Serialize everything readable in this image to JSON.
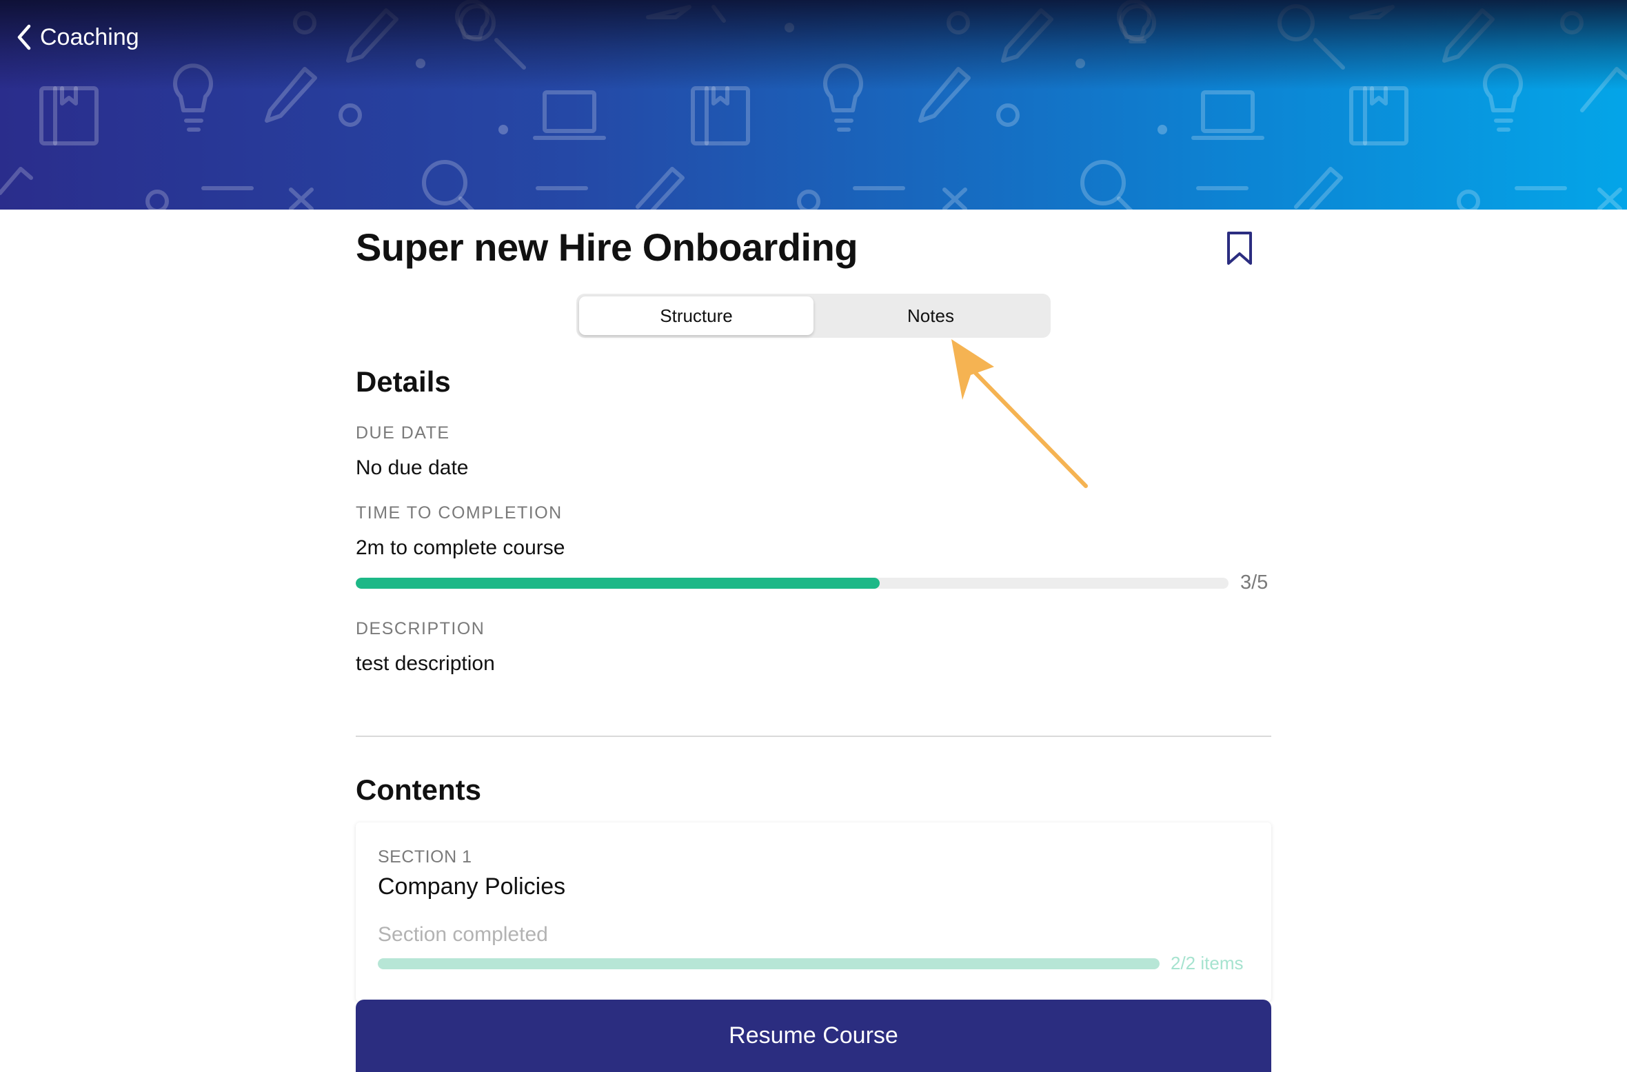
{
  "header": {
    "back_label": "Coaching"
  },
  "course": {
    "title": "Super new Hire Onboarding"
  },
  "tabs": [
    {
      "label": "Structure",
      "active": true
    },
    {
      "label": "Notes",
      "active": false
    }
  ],
  "details": {
    "heading": "Details",
    "due_date_label": "DUE DATE",
    "due_date_value": "No due date",
    "time_label": "TIME TO COMPLETION",
    "time_value": "2m to complete course",
    "progress_completed": 3,
    "progress_total": 5,
    "progress_text": "3/5",
    "description_label": "DESCRIPTION",
    "description_value": "test description"
  },
  "contents": {
    "heading": "Contents",
    "sections": [
      {
        "eyebrow": "SECTION 1",
        "title": "Company Policies",
        "status": "Section completed",
        "items_completed": 2,
        "items_total": 2,
        "count_text": "2/2 items"
      }
    ]
  },
  "footer": {
    "resume_label": "Resume Course"
  },
  "colors": {
    "accent_green": "#1db887",
    "primary_button": "#2b2d80",
    "annotation_arrow": "#f5b352"
  },
  "icons": {
    "back": "chevron-left-icon",
    "bookmark": "bookmark-icon"
  }
}
